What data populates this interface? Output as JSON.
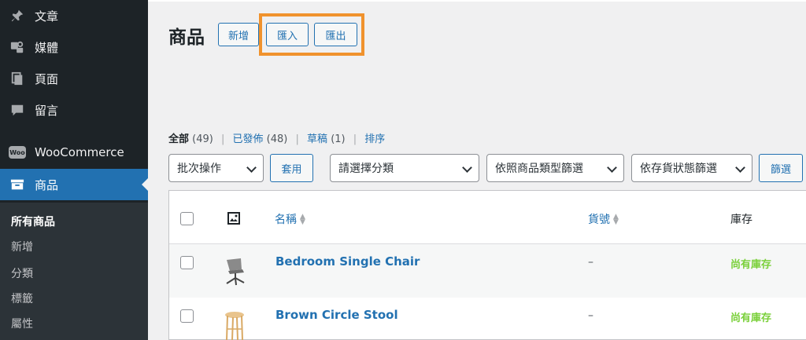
{
  "sidebar": {
    "items": [
      {
        "label": "文章",
        "icon": "pin-icon"
      },
      {
        "label": "媒體",
        "icon": "media-icon"
      },
      {
        "label": "頁面",
        "icon": "pages-icon"
      },
      {
        "label": "留言",
        "icon": "comment-icon"
      },
      {
        "label": "WooCommerce",
        "icon": "woocommerce-icon",
        "badge": "Woo"
      },
      {
        "label": "商品",
        "icon": "archive-icon"
      }
    ],
    "submenu": [
      "所有商品",
      "新增",
      "分類",
      "標籤",
      "屬性"
    ]
  },
  "header": {
    "title": "商品",
    "add_new": "新增",
    "import": "匯入",
    "export": "匯出"
  },
  "views": {
    "all": "全部",
    "all_count": "(49)",
    "published": "已發佈",
    "published_count": "(48)",
    "draft": "草稿",
    "draft_count": "(1)",
    "sort": "排序"
  },
  "filters": {
    "bulk_actions": "批次操作",
    "apply": "套用",
    "category": "請選擇分類",
    "type": "依照商品類型篩選",
    "stock": "依存貨狀態篩選",
    "filter": "篩選"
  },
  "table": {
    "columns": {
      "name": "名稱",
      "sku": "貨號",
      "stock": "庫存"
    },
    "rows": [
      {
        "name": "Bedroom Single Chair",
        "sku": "–",
        "stock": "尚有庫存"
      },
      {
        "name": "Brown Circle Stool",
        "sku": "–",
        "stock": "尚有庫存"
      }
    ]
  },
  "colors": {
    "sidebar": "#1d2327",
    "accent": "#2271b1",
    "highlight": "#f0922d",
    "in_stock": "#7ad03a"
  }
}
